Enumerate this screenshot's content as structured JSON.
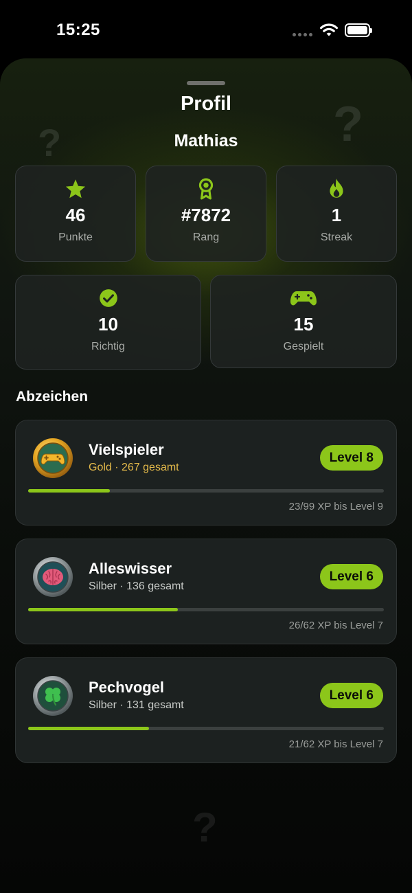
{
  "status_bar": {
    "time": "15:25"
  },
  "sheet": {
    "title": "Profil",
    "username": "Mathias"
  },
  "stats": [
    {
      "value": "46",
      "label": "Punkte",
      "icon": "star-icon"
    },
    {
      "value": "#7872",
      "label": "Rang",
      "icon": "award-ribbon-icon"
    },
    {
      "value": "1",
      "label": "Streak",
      "icon": "flame-icon"
    },
    {
      "value": "10",
      "label": "Richtig",
      "icon": "check-circle-icon"
    },
    {
      "value": "15",
      "label": "Gespielt",
      "icon": "gamepad-icon"
    }
  ],
  "badges_section": {
    "title": "Abzeichen"
  },
  "badges": [
    {
      "name": "Vielspieler",
      "subtitle": "Gold · 267 gesamt",
      "level": "Level 8",
      "xp": "23/99 XP bis Level 9",
      "progress": 0.23,
      "tier_color": "#e3b94a",
      "icon": "gamepad-medal-icon"
    },
    {
      "name": "Alleswisser",
      "subtitle": "Silber · 136 gesamt",
      "level": "Level 6",
      "xp": "26/62 XP bis Level 7",
      "progress": 0.42,
      "tier_color": "#c9ccc9",
      "icon": "brain-medal-icon"
    },
    {
      "name": "Pechvogel",
      "subtitle": "Silber · 131 gesamt",
      "level": "Level 6",
      "xp": "21/62 XP bis Level 7",
      "progress": 0.34,
      "tier_color": "#c9ccc9",
      "icon": "clover-medal-icon"
    }
  ],
  "colors": {
    "accent": "#8cc61a",
    "gold_text": "#e3b94a",
    "card_bg": "#1c2120"
  }
}
